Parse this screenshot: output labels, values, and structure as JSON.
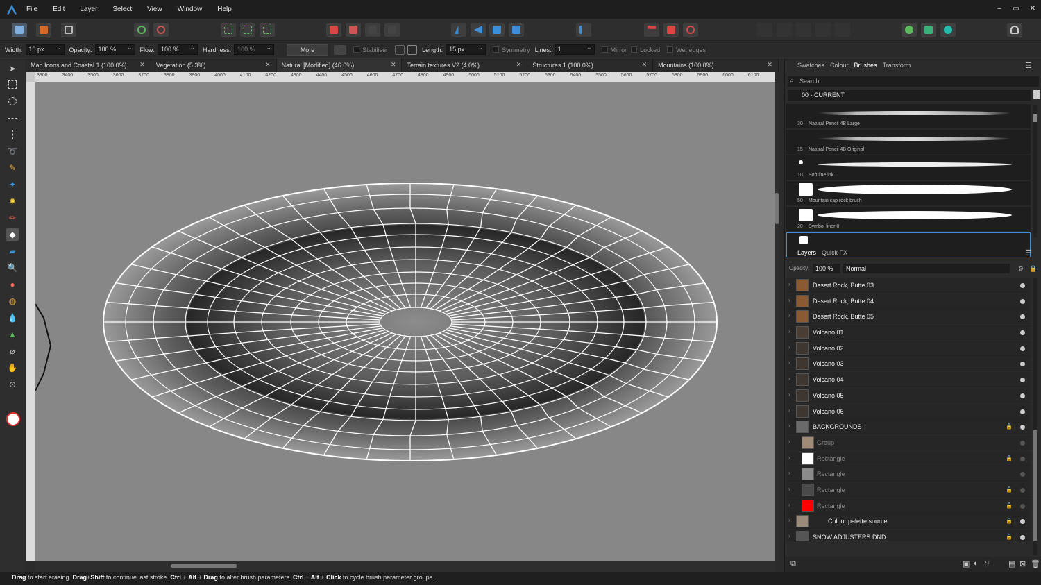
{
  "menu": [
    "File",
    "Edit",
    "Layer",
    "Select",
    "View",
    "Window",
    "Help"
  ],
  "window_controls": [
    "–",
    "▭",
    "✕"
  ],
  "context": {
    "width_label": "Width:",
    "width": "10 px",
    "opacity_label": "Opacity:",
    "opacity": "100 %",
    "flow_label": "Flow:",
    "flow": "100 %",
    "hardness_label": "Hardness:",
    "hardness": "100 %",
    "more": "More",
    "stabiliser": "Stabiliser",
    "length_label": "Length:",
    "length": "15 px",
    "symmetry": "Symmetry",
    "lines_label": "Lines:",
    "lines": "1",
    "mirror": "Mirror",
    "locked": "Locked",
    "wet_edges": "Wet edges"
  },
  "doc_tabs": [
    "Map Icons and Coastal 1 (100.0%)",
    "Vegetation (5.3%)",
    "Natural [Modified] (46.6%)",
    "Terrain textures V2 (4.0%)",
    "Structures 1 (100.0%)",
    "Mountains (100.0%)"
  ],
  "ruler_ticks": [
    "3300",
    "3400",
    "3500",
    "3600",
    "3700",
    "3800",
    "3900",
    "4000",
    "4100",
    "4200",
    "4300",
    "4400",
    "4500",
    "4600",
    "4700",
    "4800",
    "4900",
    "5000",
    "5100",
    "5200",
    "5300",
    "5400",
    "5500",
    "5600",
    "5700",
    "5800",
    "5900",
    "6000",
    "6100"
  ],
  "panel_tabs_top": [
    "Swatches",
    "Colour",
    "Brushes",
    "Transform"
  ],
  "brush_search_placeholder": "Search",
  "brush_category": "00 - CURRENT",
  "brushes": [
    {
      "size": "30",
      "name": "Natural Pencil 4B Large"
    },
    {
      "size": "15",
      "name": "Natural Pencil 4B Original"
    },
    {
      "size": "10",
      "name": "Soft line ink"
    },
    {
      "size": "50",
      "name": "Mountain cap rock brush"
    },
    {
      "size": "20",
      "name": "Symbol liner 0"
    }
  ],
  "panel_tabs_layers": [
    "Layers",
    "Quick FX"
  ],
  "layer_opacity_label": "Opacity:",
  "layer_opacity": "100 %",
  "blend_mode": "Normal",
  "layers": [
    {
      "name": "Desert Rock, Butte 03",
      "thumb": "#8a5a32"
    },
    {
      "name": "Desert Rock, Butte 04",
      "thumb": "#8a5a32"
    },
    {
      "name": "Desert Rock, Butte 05",
      "thumb": "#8a5a32"
    },
    {
      "name": "Volcano 01",
      "thumb": "#4a3d33"
    },
    {
      "name": "Volcano 02",
      "thumb": "#3e3630"
    },
    {
      "name": "Volcano 03",
      "thumb": "#3e3630"
    },
    {
      "name": "Volcano 04",
      "thumb": "#3e3630"
    },
    {
      "name": "Volcano 05",
      "thumb": "#3e3630"
    },
    {
      "name": "Volcano 06",
      "thumb": "#3e3630"
    },
    {
      "name": "BACKGROUNDS",
      "thumb": "#6a6a6a"
    },
    {
      "name": "Group",
      "thumb": "#a08a78"
    },
    {
      "name": "Rectangle",
      "thumb": "#ffffff"
    },
    {
      "name": "Rectangle",
      "thumb": "#8a8a8a"
    },
    {
      "name": "Rectangle",
      "thumb": "#4a4a4a"
    },
    {
      "name": "Rectangle",
      "thumb": "#ff0000"
    },
    {
      "name": "Colour palette source",
      "thumb": "#9a8a7a"
    },
    {
      "name": "SNOW ADJUSTERS DND",
      "thumb": "#555555"
    }
  ],
  "status": {
    "k1": "Drag",
    "t1": " to start erasing. ",
    "k2": "Drag",
    "t2": "+",
    "k3": "Shift",
    "t3": " to continue last stroke. ",
    "k4": "Ctrl",
    "t4": " + ",
    "k5": "Alt",
    "t5": " + ",
    "k6": "Drag",
    "t6": " to alter brush parameters. ",
    "k7": "Ctrl",
    "t7": " + ",
    "k8": "Alt",
    "t8": " + ",
    "k9": "Click",
    "t9": " to cycle brush parameter groups."
  },
  "colors": {
    "accent": "#3a8fd8",
    "canvas": "#878787",
    "mesh_line": "#ffffff"
  }
}
